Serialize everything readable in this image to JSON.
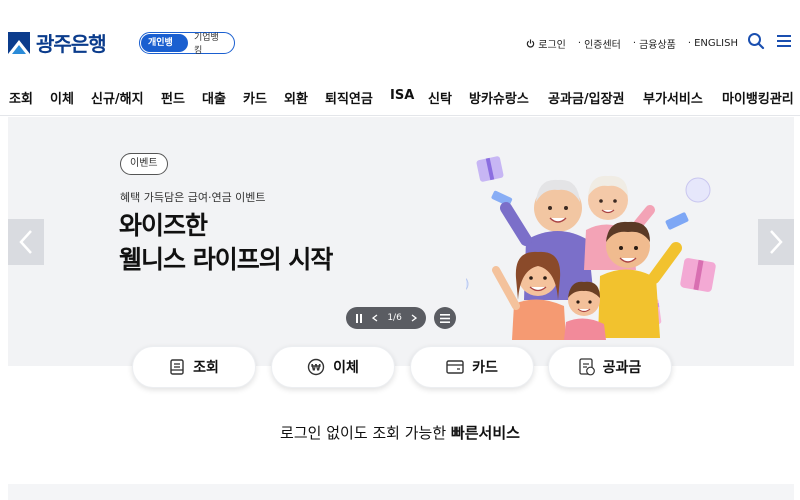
{
  "header": {
    "logo_text": "광주은행",
    "segment": {
      "active": "개인뱅킹",
      "inactive": "기업뱅킹"
    },
    "util": [
      {
        "label": "로그인",
        "icon": "power-icon"
      },
      {
        "label": "인증센터"
      },
      {
        "label": "금융상품"
      },
      {
        "label": "ENGLISH"
      }
    ],
    "search_icon": "search-icon",
    "menu_icon": "hamburger-menu-icon"
  },
  "gnb": [
    "조회",
    "이체",
    "신규/해지",
    "펀드",
    "대출",
    "카드",
    "외환",
    "퇴직연금",
    "ISA",
    "신탁",
    "방카슈랑스",
    "공과금/입장권",
    "부가서비스",
    "마이뱅킹관리"
  ],
  "hero": {
    "badge": "이벤트",
    "subtitle": "혜택 가득담은 급여·연금 이벤트",
    "title_line1": "와이즈한",
    "title_line2": "웰니스 라이프의 시작",
    "pager": {
      "current": "1",
      "total": "6",
      "separator": "/"
    }
  },
  "quick": [
    {
      "label": "조회",
      "icon": "inquiry-icon"
    },
    {
      "label": "이체",
      "icon": "transfer-won-icon"
    },
    {
      "label": "카드",
      "icon": "card-icon"
    },
    {
      "label": "공과금",
      "icon": "tax-icon"
    }
  ],
  "fast_service": {
    "prefix": "로그인 없이도 조회 가능한 ",
    "emphasis": "빠른서비스"
  },
  "colors": {
    "brand": "#0b3c8c",
    "accent": "#1a5fd0"
  }
}
